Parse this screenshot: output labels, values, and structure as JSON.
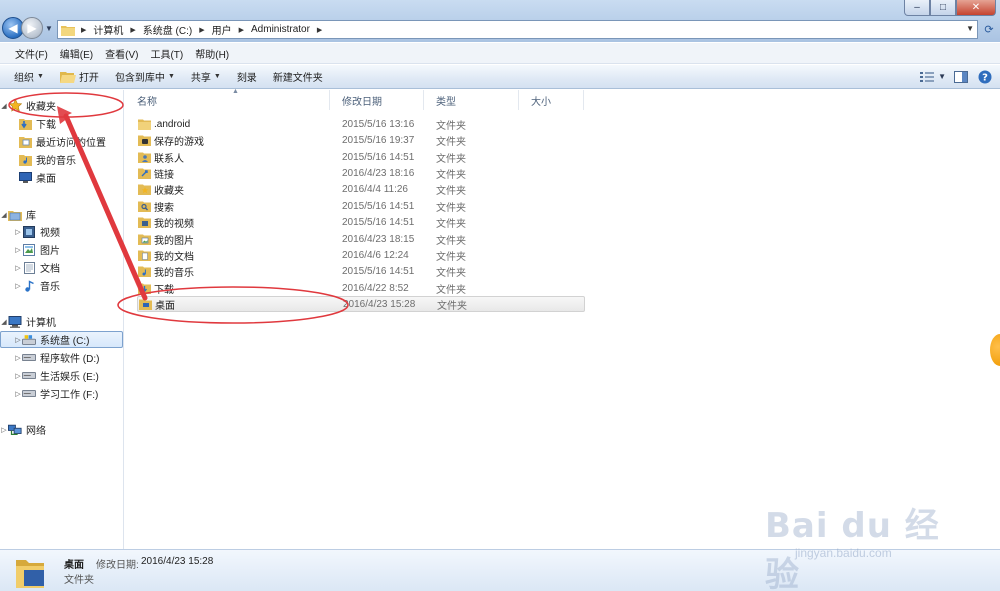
{
  "window": {
    "controls": {
      "minimize": "–",
      "maximize": "□",
      "close": "✕"
    }
  },
  "address": {
    "crumbs": [
      "计算机",
      "系统盘 (C:)",
      "用户",
      "Administrator"
    ]
  },
  "menu": [
    "文件(F)",
    "编辑(E)",
    "查看(V)",
    "工具(T)",
    "帮助(H)"
  ],
  "toolbar": {
    "organize": "组织",
    "open": "打开",
    "include_library": "包含到库中",
    "share": "共享",
    "burn": "刻录",
    "new_folder": "新建文件夹"
  },
  "navpane": {
    "favorites": "收藏夹",
    "fav_items": [
      "下载",
      "最近访问的位置",
      "我的音乐",
      "桌面"
    ],
    "libraries": "库",
    "lib_items": [
      "视频",
      "图片",
      "文档",
      "音乐"
    ],
    "computer": "计算机",
    "drives": [
      "系统盘 (C:)",
      "程序软件 (D:)",
      "生活娱乐 (E:)",
      "学习工作 (F:)"
    ],
    "network": "网络"
  },
  "columns": {
    "name": "名称",
    "date": "修改日期",
    "type": "类型",
    "size": "大小"
  },
  "files": [
    {
      "name": ".android",
      "date": "2015/5/16 13:16",
      "type": "文件夹",
      "icon": "folder-icon"
    },
    {
      "name": "保存的游戏",
      "date": "2015/5/16 19:37",
      "type": "文件夹",
      "icon": "saved-games-icon"
    },
    {
      "name": "联系人",
      "date": "2015/5/16 14:51",
      "type": "文件夹",
      "icon": "contacts-icon"
    },
    {
      "name": "链接",
      "date": "2016/4/23 18:16",
      "type": "文件夹",
      "icon": "links-icon"
    },
    {
      "name": "收藏夹",
      "date": "2016/4/4 11:26",
      "type": "文件夹",
      "icon": "favorites-icon"
    },
    {
      "name": "搜索",
      "date": "2015/5/16 14:51",
      "type": "文件夹",
      "icon": "searches-icon"
    },
    {
      "name": "我的视频",
      "date": "2015/5/16 14:51",
      "type": "文件夹",
      "icon": "videos-icon"
    },
    {
      "name": "我的图片",
      "date": "2016/4/23 18:15",
      "type": "文件夹",
      "icon": "pictures-icon"
    },
    {
      "name": "我的文档",
      "date": "2016/4/6 12:24",
      "type": "文件夹",
      "icon": "documents-icon"
    },
    {
      "name": "我的音乐",
      "date": "2015/5/16 14:51",
      "type": "文件夹",
      "icon": "music-icon"
    },
    {
      "name": "下载",
      "date": "2016/4/22 8:52",
      "type": "文件夹",
      "icon": "downloads-icon"
    },
    {
      "name": "桌面",
      "date": "2016/4/23 15:28",
      "type": "文件夹",
      "icon": "desktop-folder-icon"
    }
  ],
  "details": {
    "name": "桌面",
    "meta_label": "修改日期:",
    "meta_value": "2016/4/23 15:28",
    "type": "文件夹"
  },
  "watermark": {
    "text": "Bai du 经验",
    "url": "jingyan.baidu.com"
  },
  "colors": {
    "annotation": "#e0393e",
    "selection": "#d7e8fb",
    "accent": "#2a6fc2"
  }
}
